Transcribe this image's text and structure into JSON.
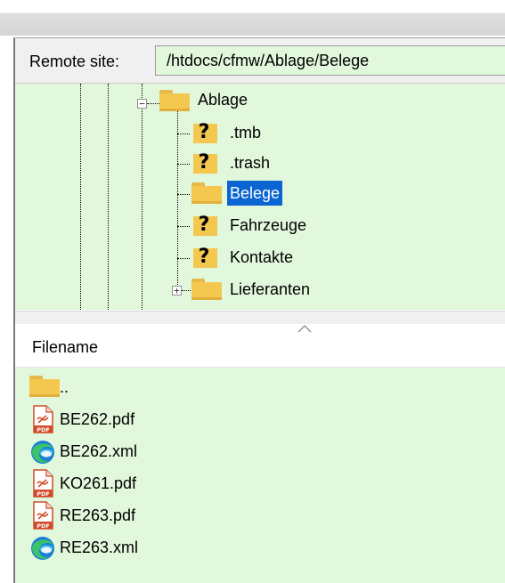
{
  "remote_site": {
    "label": "Remote site:",
    "path": "/htdocs/cfmw/Ablage/Belege"
  },
  "tree": {
    "parent": {
      "label": "Ablage",
      "expanded": true,
      "icon": "folder-icon"
    },
    "children": [
      {
        "label": ".tmb",
        "icon": "unknown-folder-icon",
        "selected": false
      },
      {
        "label": ".trash",
        "icon": "unknown-folder-icon",
        "selected": false
      },
      {
        "label": "Belege",
        "icon": "folder-icon",
        "selected": true
      },
      {
        "label": "Fahrzeuge",
        "icon": "unknown-folder-icon",
        "selected": false
      },
      {
        "label": "Kontakte",
        "icon": "unknown-folder-icon",
        "selected": false
      },
      {
        "label": "Lieferanten",
        "icon": "folder-icon",
        "selected": false,
        "collapsed": true
      }
    ]
  },
  "file_list": {
    "column_header": "Filename",
    "sort": "ascending",
    "files": [
      {
        "name": "..",
        "icon": "folder-icon"
      },
      {
        "name": "BE262.pdf",
        "icon": "pdf-icon"
      },
      {
        "name": "BE262.xml",
        "icon": "edge-icon"
      },
      {
        "name": "KO261.pdf",
        "icon": "pdf-icon"
      },
      {
        "name": "RE263.pdf",
        "icon": "pdf-icon"
      },
      {
        "name": "RE263.xml",
        "icon": "edge-icon"
      }
    ]
  },
  "colors": {
    "tree_background": "#e2f8dc",
    "selection": "#0a64d2",
    "folder": "#f4c84f"
  }
}
